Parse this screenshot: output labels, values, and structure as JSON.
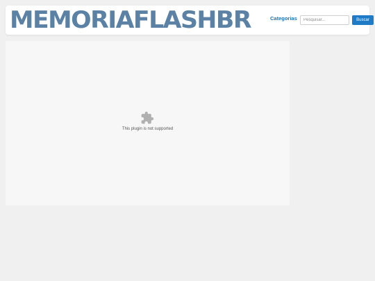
{
  "header": {
    "logo_text": "MEMORIAFLASHBR",
    "nav_categories": "Categorias",
    "search": {
      "placeholder": "Pesquisar...",
      "value": "",
      "button_label": "Buscar"
    }
  },
  "content": {
    "plugin_message": "This plugin is not supported",
    "plugin_icon": "puzzle-piece-icon"
  },
  "colors": {
    "logo": "#5b82a4",
    "link": "#1f73b7",
    "button": "#1f7bc5",
    "page_background": "#f0f0f0",
    "content_background": "#f7f7f7",
    "icon": "#b0b0b0"
  }
}
